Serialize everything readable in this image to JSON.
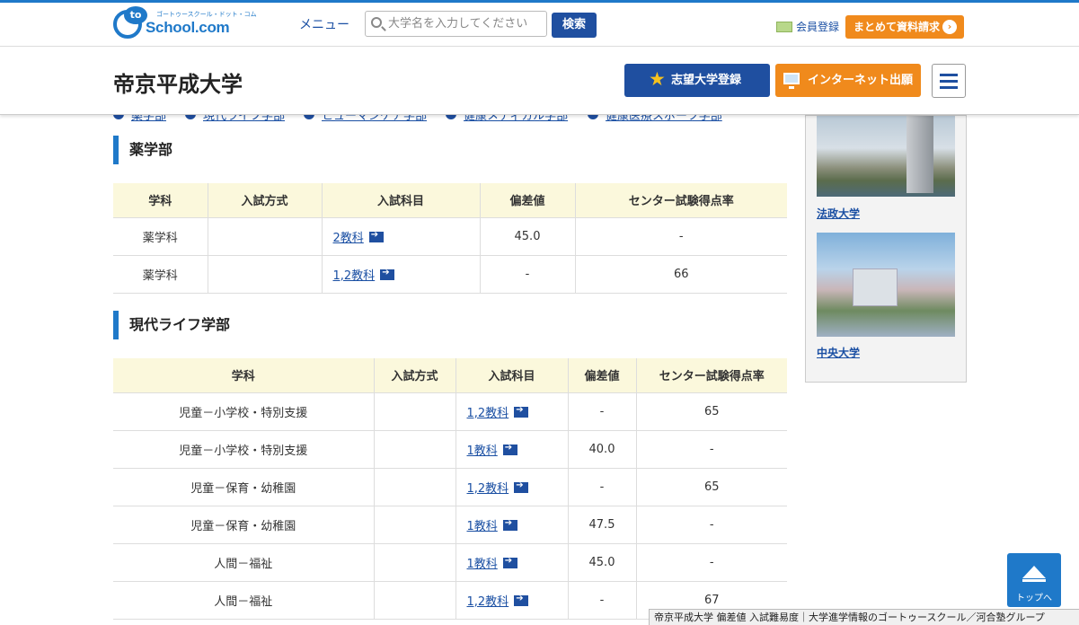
{
  "header": {
    "logo_text": "School.com",
    "logo_to": "to",
    "logo_sub": "ゴートゥースクール・ドット・コム",
    "menu_label": "メニュー",
    "search_placeholder": "大学名を入力してください",
    "search_button": "検索",
    "member_label": "会員登録",
    "bulk_request_label": "まとめて資料請求",
    "bulk_arrow": "›"
  },
  "titlebar": {
    "university": "帝京平成大学",
    "wish_button": "志望大学登録",
    "star": "★",
    "net_button": "インターネット出願"
  },
  "nav": [
    "薬学部",
    "現代ライフ学部",
    "ヒューマンケア学部",
    "健康メディカル学部",
    "健康医療スポーツ学部"
  ],
  "sections": [
    {
      "heading": "薬学部",
      "headers": [
        "学科",
        "入試方式",
        "入試科目",
        "偏差値",
        "センター試験得点率"
      ],
      "rows": [
        {
          "dept": "薬学科",
          "method": "",
          "subjects": "2教科",
          "deviation": "45.0",
          "center_rate": "-"
        },
        {
          "dept": "薬学科",
          "method": "",
          "subjects": "1,2教科",
          "deviation": "-",
          "center_rate": "66"
        }
      ]
    },
    {
      "heading": "現代ライフ学部",
      "headers": [
        "学科",
        "入試方式",
        "入試科目",
        "偏差値",
        "センター試験得点率"
      ],
      "rows": [
        {
          "dept": "児童－小学校・特別支援",
          "method": "",
          "subjects": "1,2教科",
          "deviation": "-",
          "center_rate": "65"
        },
        {
          "dept": "児童－小学校・特別支援",
          "method": "",
          "subjects": "1教科",
          "deviation": "40.0",
          "center_rate": "-"
        },
        {
          "dept": "児童－保育・幼稚園",
          "method": "",
          "subjects": "1,2教科",
          "deviation": "-",
          "center_rate": "65"
        },
        {
          "dept": "児童－保育・幼稚園",
          "method": "",
          "subjects": "1教科",
          "deviation": "47.5",
          "center_rate": "-"
        },
        {
          "dept": "人間－福祉",
          "method": "",
          "subjects": "1教科",
          "deviation": "45.0",
          "center_rate": "-"
        },
        {
          "dept": "人間－福祉",
          "method": "",
          "subjects": "1,2教科",
          "deviation": "-",
          "center_rate": "67"
        }
      ]
    }
  ],
  "sidebar": {
    "items": [
      {
        "caption": "法政大学"
      },
      {
        "caption": "中央大学"
      }
    ]
  },
  "totop_label": "トップへ",
  "statusbar_text": "帝京平成大学 偏差値 入試難易度｜大学進学情報のゴートゥースクール／河合塾グループ"
}
